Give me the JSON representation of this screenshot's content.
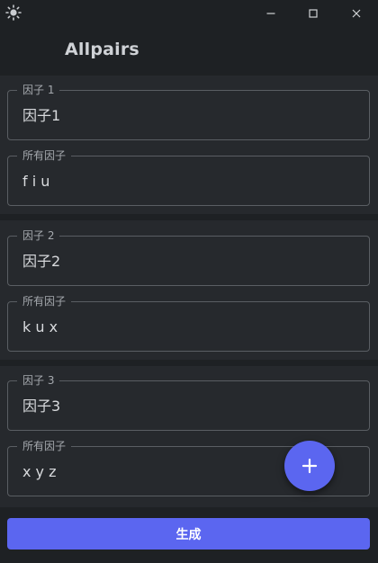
{
  "window": {
    "title": "Allpairs",
    "controls": [
      "minimize-icon",
      "maximize-icon",
      "close-icon"
    ]
  },
  "app_icon": "sun-icon",
  "factors": [
    {
      "name_label": "因子 1",
      "name_value": "因子1",
      "values_label": "所有因子",
      "values_value": "f i u"
    },
    {
      "name_label": "因子 2",
      "name_value": "因子2",
      "values_label": "所有因子",
      "values_value": "k u x"
    },
    {
      "name_label": "因子 3",
      "name_value": "因子3",
      "values_label": "所有因子",
      "values_value": "x y z"
    }
  ],
  "fab": {
    "icon": "plus-icon"
  },
  "generate_button": {
    "label": "生成"
  },
  "colors": {
    "background": "#1e2124",
    "card": "#26292d",
    "accent": "#5b66f0",
    "border": "#5a5e63"
  }
}
